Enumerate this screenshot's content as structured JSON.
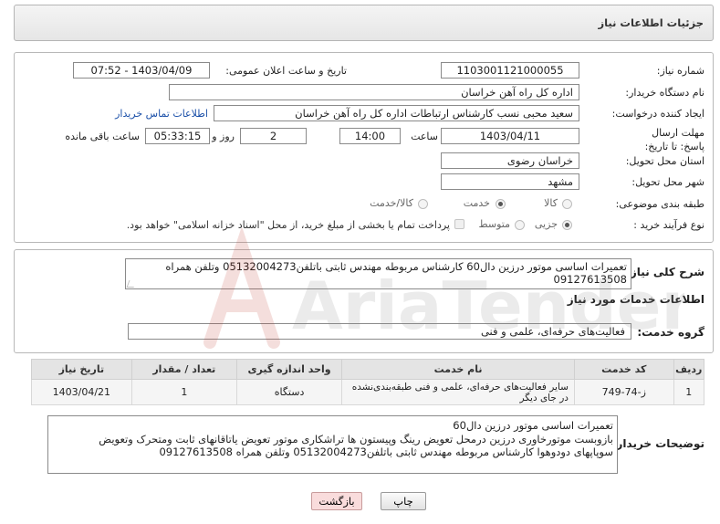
{
  "header": {
    "title": "جزئیات اطلاعات نیاز"
  },
  "need_number": {
    "label": "شماره نیاز:",
    "value": "1103001121000055"
  },
  "announce_datetime": {
    "label": "تاریخ و ساعت اعلان عمومی:",
    "value": "1403/04/09 - 07:52"
  },
  "buyer_org": {
    "label": "نام دستگاه خریدار:",
    "value": "اداره کل راه آهن خراسان"
  },
  "requester": {
    "label": "ایجاد کننده درخواست:",
    "value": "سعید محبی نسب کارشناس ارتباطات اداره کل راه آهن خراسان",
    "contact_link": "اطلاعات تماس خریدار"
  },
  "deadline": {
    "label": "مهلت ارسال پاسخ: تا تاریخ:",
    "date": "1403/04/11",
    "time_label": "ساعت",
    "time": "14:00",
    "days": "2",
    "days_label": "روز و",
    "remaining": "05:33:15",
    "remaining_label": "ساعت باقی مانده"
  },
  "province": {
    "label": "استان محل تحویل:",
    "value": "خراسان رضوی"
  },
  "city": {
    "label": "شهر محل تحویل:",
    "value": "مشهد"
  },
  "category": {
    "label": "طبقه بندی موضوعی:",
    "options": [
      "کالا",
      "خدمت",
      "کالا/خدمت"
    ],
    "selected": "خدمت"
  },
  "purchase_type": {
    "label": "نوع فرآیند خرید :",
    "options": [
      "جزیی",
      "متوسط"
    ],
    "selected": "جزیی",
    "note": "پرداخت تمام یا بخشی از مبلغ خرید، از محل \"اسناد خزانه اسلامی\" خواهد بود."
  },
  "summary": {
    "label": "شرح کلی نیاز:",
    "text": "تعمیرات اساسی موتور درزین دال60 کارشناس مربوطه مهندس ثابتی باتلفن05132004273 وتلفن همراه 09127613508"
  },
  "services_heading": "اطلاعات خدمات مورد نیاز",
  "service_group": {
    "label": "گروه خدمت:",
    "value": "فعالیت‌های حرفه‌ای، علمی و فنی"
  },
  "table": {
    "headers": [
      "ردیف",
      "کد خدمت",
      "نام خدمت",
      "واحد اندازه گیری",
      "تعداد / مقدار",
      "تاریخ نیاز"
    ],
    "rows": [
      [
        "1",
        "ز-74-749",
        "سایر فعالیت‌های حرفه‌ای، علمی و فنی طبقه‌بندی‌نشده در جای دیگر",
        "دستگاه",
        "1",
        "1403/04/21"
      ]
    ]
  },
  "buyer_notes": {
    "label": "توضیحات خریدار:",
    "lines": [
      "تعمیرات اساسی موتور درزین دال60",
      "بازوبست موتورخاوری درزین درمحل تعویض رینگ وپیستون ها تراشکاری موتور تعویض یاتاقانهای ثابت ومتحرک وتعویض",
      "سوپاپهای دودوهوا کارشناس مربوطه مهندس ثابتی باتلفن05132004273 وتلفن همراه 09127613508"
    ]
  },
  "buttons": {
    "print": "چاپ",
    "back": "بازگشت"
  },
  "watermark": {
    "text": "AriaTender.net"
  }
}
